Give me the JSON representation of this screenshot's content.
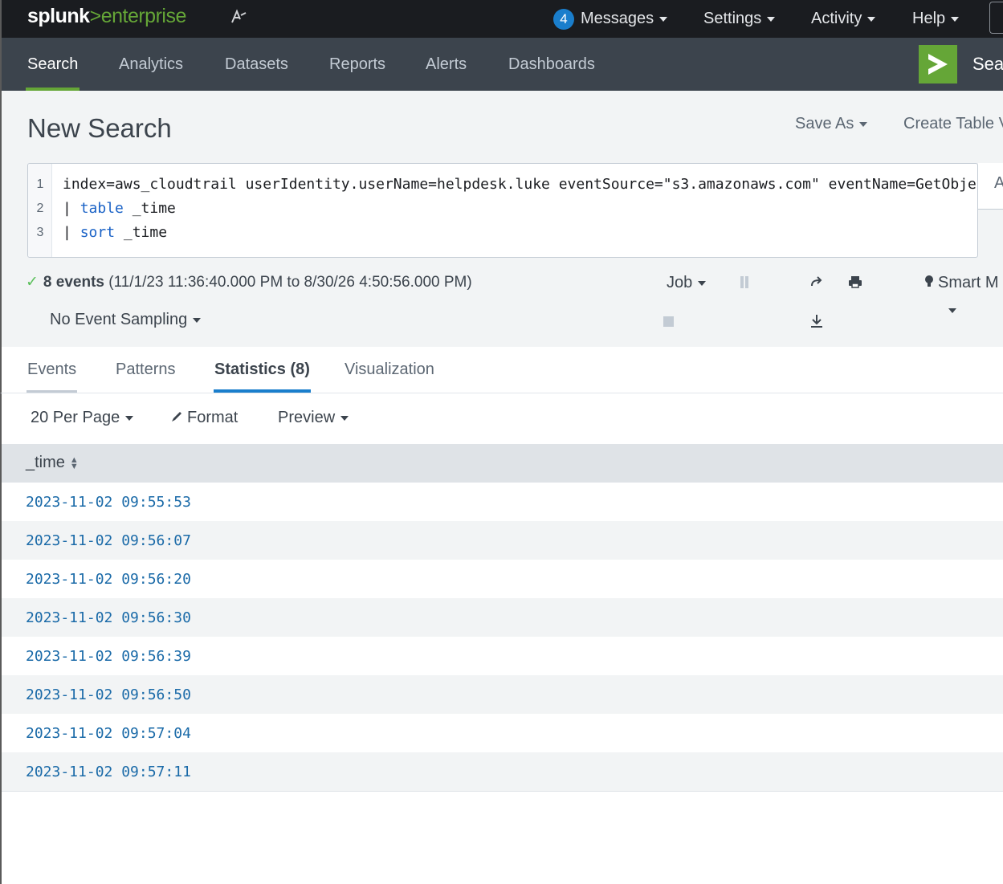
{
  "topbar": {
    "logo_main": "splunk",
    "logo_gt": ">",
    "logo_product": "enterprise",
    "messages_count": "4",
    "messages_label": "Messages",
    "settings_label": "Settings",
    "activity_label": "Activity",
    "help_label": "Help"
  },
  "appbar": {
    "nav": [
      "Search",
      "Analytics",
      "Datasets",
      "Reports",
      "Alerts",
      "Dashboards"
    ],
    "app_title": "Sea"
  },
  "page": {
    "title": "New Search",
    "save_as": "Save As",
    "create_table": "Create Table V"
  },
  "query": {
    "line_numbers": [
      "1",
      "2",
      "3"
    ],
    "line1": "index=aws_cloudtrail userIdentity.userName=helpdesk.luke eventSource=\"s3.amazonaws.com\" eventName=GetObject",
    "line2_pipe": "| ",
    "line2_cmd": "table",
    "line2_arg": " _time",
    "line3_pipe": "| ",
    "line3_cmd": "sort",
    "line3_arg": " _time",
    "side_label": "A"
  },
  "status": {
    "count_text": "8 events",
    "range_text": "(11/1/23 11:36:40.000 PM to 8/30/26 4:50:56.000 PM)",
    "job_label": "Job",
    "mode_label": "Smart M",
    "sampling_label": "No Event Sampling"
  },
  "tabs": {
    "events": "Events",
    "patterns": "Patterns",
    "statistics": "Statistics (8)",
    "visualization": "Visualization"
  },
  "toolbar": {
    "per_page": "20 Per Page",
    "format": "Format",
    "preview": "Preview"
  },
  "table": {
    "column": "_time",
    "rows": [
      "2023-11-02 09:55:53",
      "2023-11-02 09:56:07",
      "2023-11-02 09:56:20",
      "2023-11-02 09:56:30",
      "2023-11-02 09:56:39",
      "2023-11-02 09:56:50",
      "2023-11-02 09:57:04",
      "2023-11-02 09:57:11"
    ]
  },
  "colors": {
    "brand_green": "#65a637",
    "accent_blue": "#1a7ecc",
    "topbar_bg": "#1a1c20",
    "appbar_bg": "#3c444d"
  }
}
